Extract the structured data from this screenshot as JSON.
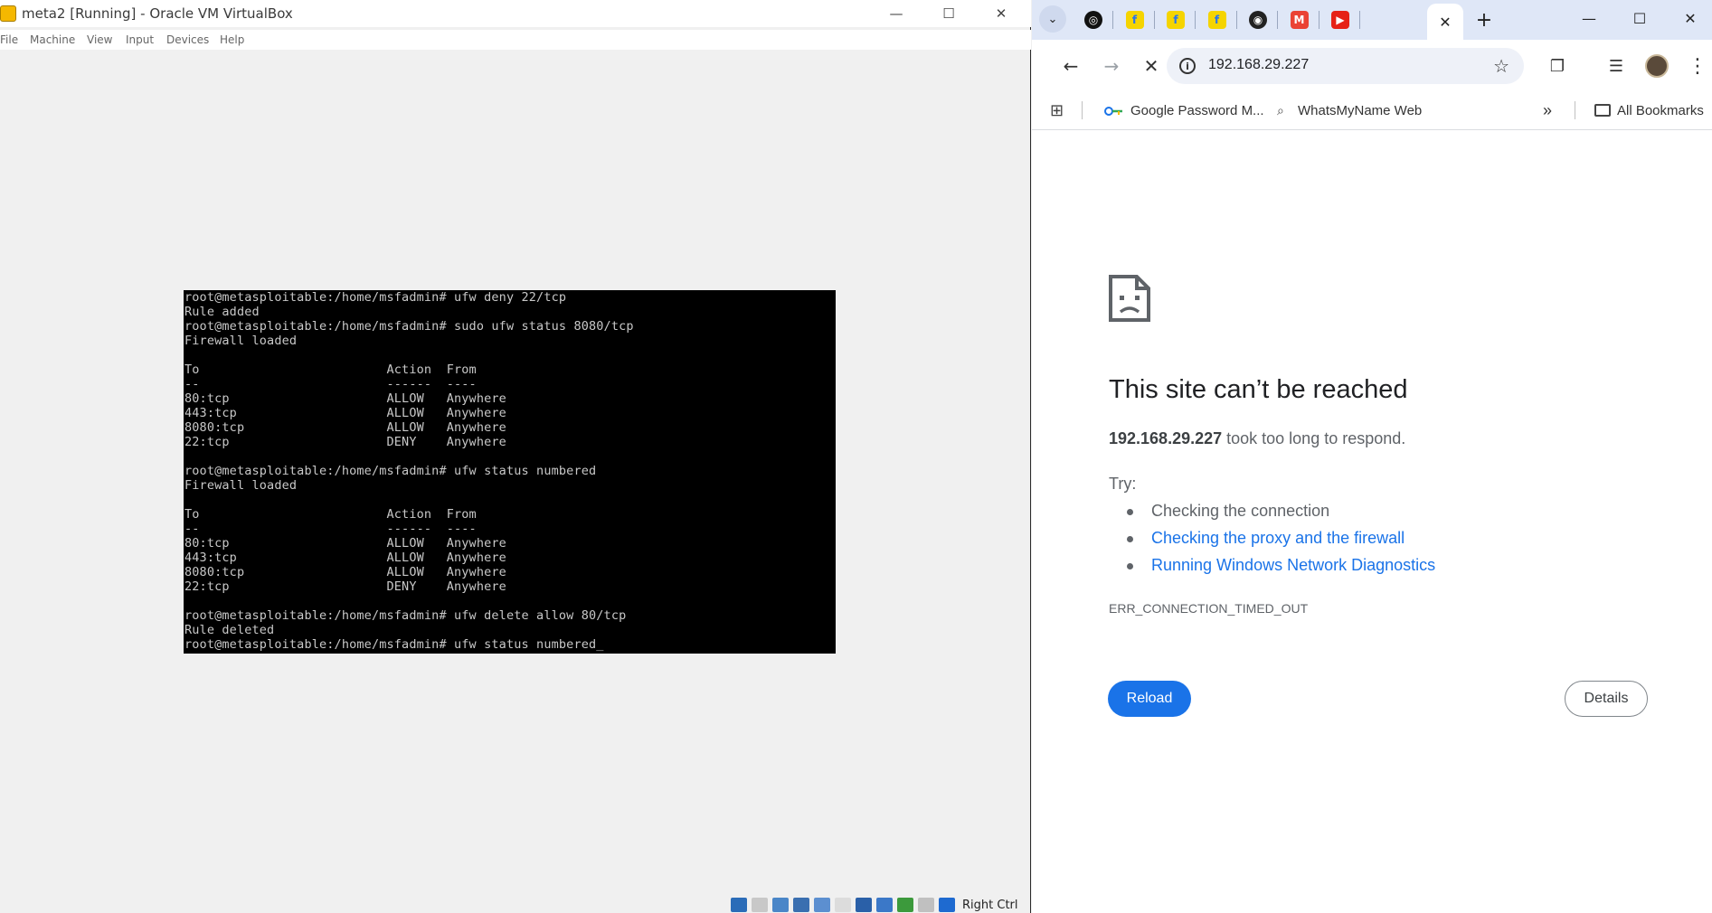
{
  "vbox": {
    "title": "meta2 [Running] - Oracle VM VirtualBox",
    "menu": [
      "File",
      "Machine",
      "View",
      "Input",
      "Devices",
      "Help"
    ],
    "terminal_lines": [
      "root@metasploitable:/home/msfadmin# ufw deny 22/tcp",
      "Rule added",
      "root@metasploitable:/home/msfadmin# sudo ufw status 8080/tcp",
      "Firewall loaded",
      "",
      "To                         Action  From",
      "--                         ------  ----",
      "80:tcp                     ALLOW   Anywhere",
      "443:tcp                    ALLOW   Anywhere",
      "8080:tcp                   ALLOW   Anywhere",
      "22:tcp                     DENY    Anywhere",
      "",
      "root@metasploitable:/home/msfadmin# ufw status numbered",
      "Firewall loaded",
      "",
      "To                         Action  From",
      "--                         ------  ----",
      "80:tcp                     ALLOW   Anywhere",
      "443:tcp                    ALLOW   Anywhere",
      "8080:tcp                   ALLOW   Anywhere",
      "22:tcp                     DENY    Anywhere",
      "",
      "root@metasploitable:/home/msfadmin# ufw delete allow 80/tcp",
      "Rule deleted",
      "root@metasploitable:/home/msfadmin# ufw status numbered_"
    ],
    "host_key_label": "Right Ctrl",
    "status_icon_colors": [
      "#2b6cb8",
      "#c8c8c8",
      "#4a86c8",
      "#3a6fb0",
      "#5c8fd0",
      "#dcdcdc",
      "#2a60a8",
      "#3b78c8",
      "#3c9a3c",
      "#c0c0c0",
      "#1e6ad0"
    ]
  },
  "chrome": {
    "pinned_tab_colors": [
      "#111111",
      "#f5d400",
      "#f5d400",
      "#f5d400",
      "#222222",
      "#ea4335",
      "#e62117"
    ],
    "pinned_tab_glyphs": [
      "◎",
      "f",
      "f",
      "f",
      "◉",
      "M",
      "▶"
    ],
    "url": "192.168.29.227",
    "bookmarks": [
      "Google Password M...",
      "WhatsMyName Web"
    ],
    "all_bookmarks": "All Bookmarks",
    "error": {
      "title": "This site can’t be reached",
      "host": "192.168.29.227",
      "desc": " took too long to respond.",
      "try_label": "Try:",
      "suggestions": [
        {
          "text": "Checking the connection",
          "link": false
        },
        {
          "text": "Checking the proxy and the firewall",
          "link": true
        },
        {
          "text": "Running Windows Network Diagnostics",
          "link": true
        }
      ],
      "code": "ERR_CONNECTION_TIMED_OUT",
      "reload_label": "Reload",
      "details_label": "Details"
    },
    "colors": {
      "link": "#1a73e8",
      "text": "#5f6368"
    }
  }
}
